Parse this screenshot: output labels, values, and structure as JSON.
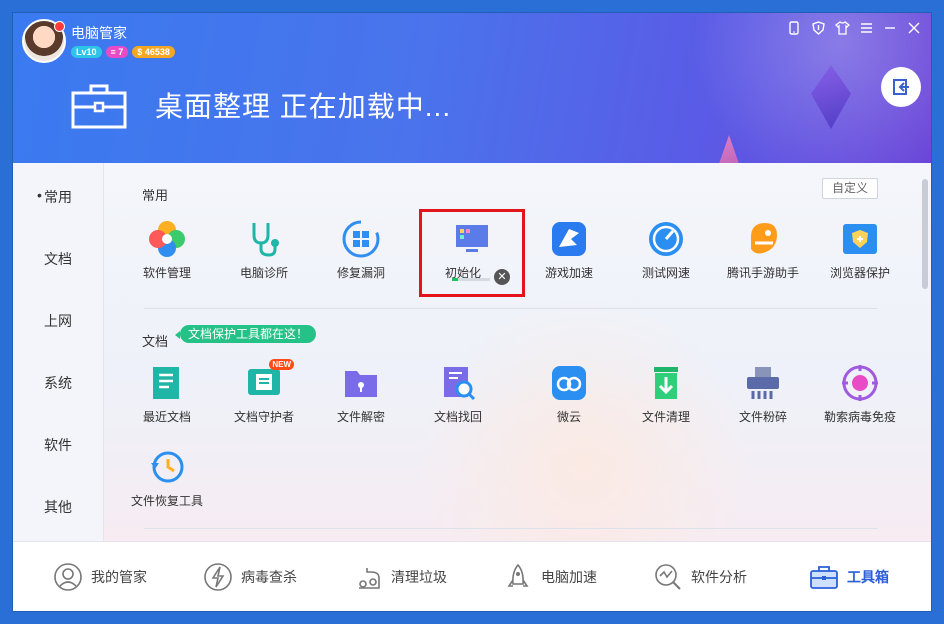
{
  "app": {
    "name": "电脑管家",
    "level": "Lv10",
    "messages": "7",
    "coins": "46538",
    "page_title": "桌面整理 正在加载中...",
    "window_buttons": [
      "phone-icon",
      "shield-icon",
      "shirt-icon",
      "menu-icon",
      "minimize-icon",
      "close-icon"
    ]
  },
  "nav": {
    "items": [
      "常用",
      "文档",
      "上网",
      "系统",
      "软件",
      "其他"
    ],
    "active": "常用"
  },
  "sections": {
    "common": {
      "title": "常用",
      "custom_label": "自定义",
      "tools": [
        {
          "label": "软件管理",
          "icon": "flower-app-icon"
        },
        {
          "label": "电脑诊所",
          "icon": "stethoscope-icon"
        },
        {
          "label": "修复漏洞",
          "icon": "windows-repair-icon"
        },
        {
          "label": "初始化",
          "icon": "desktop-organize-icon"
        },
        {
          "label": "游戏加速",
          "icon": "game-boost-icon"
        },
        {
          "label": "测试网速",
          "icon": "speedometer-icon"
        },
        {
          "label": "腾讯手游助手",
          "icon": "mobile-game-assistant-icon"
        },
        {
          "label": "浏览器保护",
          "icon": "browser-shield-icon"
        }
      ]
    },
    "docs": {
      "title": "文档",
      "tag": "文档保护工具都在这！",
      "new_badge": "NEW",
      "tools": [
        {
          "label": "最近文档",
          "icon": "recent-docs-icon"
        },
        {
          "label": "文档守护者",
          "icon": "doc-guard-icon"
        },
        {
          "label": "文件解密",
          "icon": "file-decrypt-icon"
        },
        {
          "label": "文档找回",
          "icon": "doc-search-icon"
        },
        {
          "label": "微云",
          "icon": "weiyun-cloud-icon"
        },
        {
          "label": "文件清理",
          "icon": "file-clean-icon"
        },
        {
          "label": "文件粉碎",
          "icon": "shredder-icon"
        },
        {
          "label": "勒索病毒免疫",
          "icon": "ransomware-immune-icon"
        },
        {
          "label": "文件恢复工具",
          "icon": "file-restore-icon"
        }
      ]
    }
  },
  "loading": {
    "progress": 0.15
  },
  "bottom_nav": [
    {
      "label": "我的管家",
      "icon": "butler-icon"
    },
    {
      "label": "病毒查杀",
      "icon": "virus-scan-icon"
    },
    {
      "label": "清理垃圾",
      "icon": "vacuum-icon"
    },
    {
      "label": "电脑加速",
      "icon": "rocket-icon"
    },
    {
      "label": "软件分析",
      "icon": "analysis-icon"
    },
    {
      "label": "工具箱",
      "icon": "toolbox-icon",
      "active": true
    }
  ],
  "colors": {
    "accent": "#2a5fd9",
    "highlight": "#e4151a",
    "tag_green": "#25c287"
  }
}
